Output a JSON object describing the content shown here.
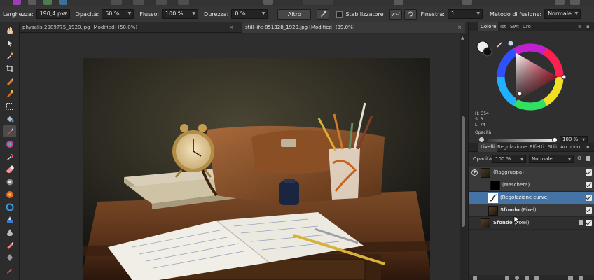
{
  "context_toolbar": {
    "width_label": "Larghezza:",
    "width_value": "190,4 px",
    "opacity_label": "Opacità:",
    "opacity_value": "50 %",
    "flow_label": "Flusso:",
    "flow_value": "100 %",
    "hardness_label": "Durezza:",
    "hardness_value": "0 %",
    "more_button": "Altro",
    "stabilizer_label": "Stabilizzatore",
    "window_label": "Finestra:",
    "window_value": "1",
    "blend_label": "Metodo di fusione:",
    "blend_value": "Normale"
  },
  "tabs": [
    {
      "label": "physalis-2989775_1920.jpg [Modified] (50.0%)",
      "close": "×"
    },
    {
      "label": "still-life-851328_1920.jpg [Modified] (39.0%)",
      "close": "×"
    }
  ],
  "color_panel": {
    "tabs": [
      "Colore",
      "Ist",
      "Swt",
      "Cro"
    ],
    "h": "H: 354",
    "s": "S: 3",
    "l": "L: 74",
    "opacity_label": "Opacità",
    "opacity_value": "100 %"
  },
  "layers_panel": {
    "tabs": [
      "Livelli",
      "Regolazione",
      "Effetti",
      "Stili",
      "Archivio"
    ],
    "opacity_label": "Opacità:",
    "opacity_value": "100 %",
    "blend_value": "Normale",
    "layers": [
      {
        "name": "(Raggruppa)",
        "type": ""
      },
      {
        "name": "(Maschera)",
        "type": ""
      },
      {
        "name": "(Regolazione curve)",
        "type": ""
      },
      {
        "name": "Sfondo",
        "type": "(Pixel)"
      },
      {
        "name": "Sfondo",
        "type": "(Pixel)"
      }
    ]
  },
  "colors": {
    "accent": "#4673a6",
    "selected_color": "#d8303f"
  },
  "icons": {
    "tools": [
      "hand-icon",
      "pointer-icon",
      "eyedropper-icon",
      "crop-icon",
      "selection-brush-icon",
      "flood-select-icon",
      "marquee-icon",
      "fill-icon",
      "paint-brush-icon",
      "color-replace-icon",
      "dodge-icon",
      "erase-icon",
      "clone-icon",
      "red-eye-icon",
      "blur-icon",
      "liquify-icon",
      "sponge-icon",
      "patch-icon"
    ]
  }
}
